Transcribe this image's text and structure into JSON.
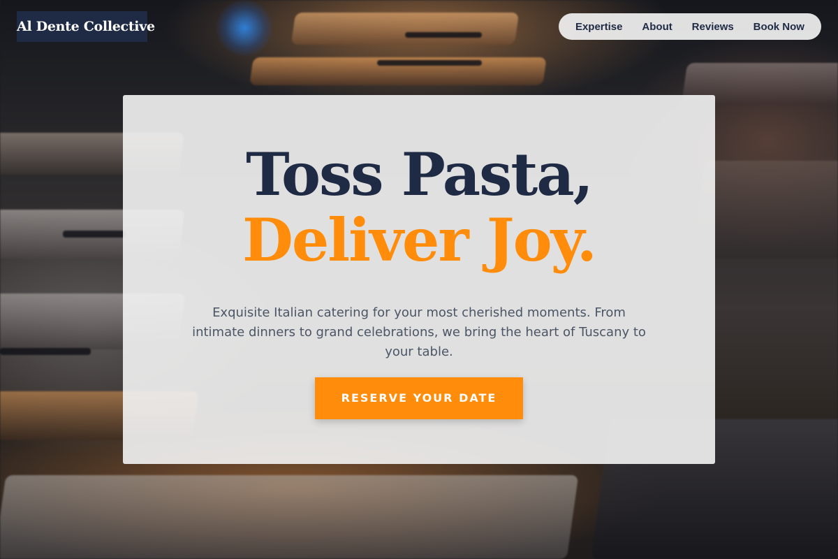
{
  "brand": {
    "logo_text": "Al Dente Collective"
  },
  "nav": {
    "items": [
      {
        "label": "Expertise"
      },
      {
        "label": "About"
      },
      {
        "label": "Reviews"
      },
      {
        "label": "Book Now"
      }
    ]
  },
  "hero": {
    "title_line_1": "Toss Pasta,",
    "title_line_2": "Deliver Joy.",
    "subtitle": "Exquisite Italian catering for your most cherished moments. From intimate dinners to grand celebrations, we bring the heart of Tuscany to your table.",
    "cta_label": "RESERVE YOUR DATE"
  },
  "colors": {
    "navy": "#1f2a44",
    "accent_orange": "#ff8c0a",
    "card_background": "#f2f2f2",
    "body_text": "#4a5565"
  },
  "background": {
    "image_description_icon": "catering-chafing-dishes-photo"
  }
}
